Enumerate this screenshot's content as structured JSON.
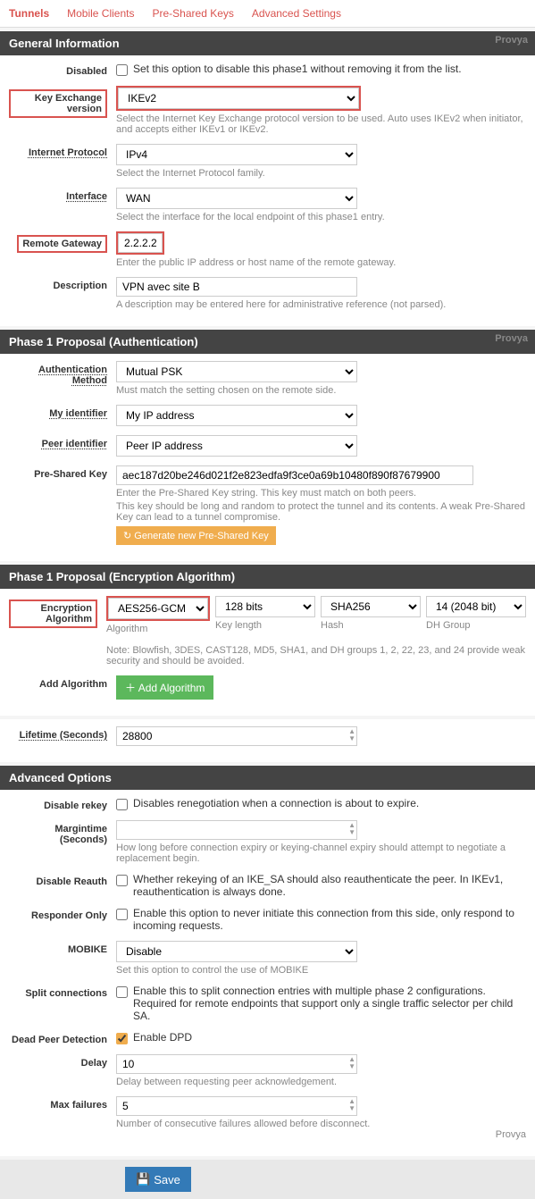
{
  "tabs": {
    "tunnels": "Tunnels",
    "mobile": "Mobile Clients",
    "psk": "Pre-Shared Keys",
    "adv": "Advanced Settings"
  },
  "watermark": "Provya",
  "general": {
    "title": "General Information",
    "disabled": {
      "label": "Disabled",
      "text": "Set this option to disable this phase1 without removing it from the list."
    },
    "kev": {
      "label": "Key Exchange version",
      "value": "IKEv2",
      "help": "Select the Internet Key Exchange protocol version to be used. Auto uses IKEv2 when initiator, and accepts either IKEv1 or IKEv2."
    },
    "ip": {
      "label": "Internet Protocol",
      "value": "IPv4",
      "help": "Select the Internet Protocol family."
    },
    "iface": {
      "label": "Interface",
      "value": "WAN",
      "help": "Select the interface for the local endpoint of this phase1 entry."
    },
    "rg": {
      "label": "Remote Gateway",
      "value": "2.2.2.2",
      "help": "Enter the public IP address or host name of the remote gateway."
    },
    "desc": {
      "label": "Description",
      "value": "VPN avec site B",
      "help": "A description may be entered here for administrative reference (not parsed)."
    }
  },
  "p1auth": {
    "title": "Phase 1 Proposal (Authentication)",
    "method": {
      "label": "Authentication Method",
      "value": "Mutual PSK",
      "help": "Must match the setting chosen on the remote side."
    },
    "myid": {
      "label": "My identifier",
      "value": "My IP address"
    },
    "peerid": {
      "label": "Peer identifier",
      "value": "Peer IP address"
    },
    "psk": {
      "label": "Pre-Shared Key",
      "value": "aec187d20be246d021f2e823edfa9f3ce0a69b10480f890f87679900",
      "help1": "Enter the Pre-Shared Key string. This key must match on both peers.",
      "help2": "This key should be long and random to protect the tunnel and its contents. A weak Pre-Shared Key can lead to a tunnel compromise.",
      "btn": "Generate new Pre-Shared Key"
    }
  },
  "p1enc": {
    "title": "Phase 1 Proposal (Encryption Algorithm)",
    "ealabel": "Encryption Algorithm",
    "alg": "AES256-GCM",
    "algsub": "Algorithm",
    "klen": "128 bits",
    "klensub": "Key length",
    "hash": "SHA256",
    "hashsub": "Hash",
    "dh": "14 (2048 bit)",
    "dhsub": "DH Group",
    "note": "Note: Blowfish, 3DES, CAST128, MD5, SHA1, and DH groups 1, 2, 22, 23, and 24 provide weak security and should be avoided.",
    "addlabel": "Add Algorithm",
    "addbtn": "Add Algorithm",
    "lifetime": {
      "label": "Lifetime (Seconds)",
      "value": "28800"
    }
  },
  "advopts": {
    "title": "Advanced Options",
    "rekey": {
      "label": "Disable rekey",
      "text": "Disables renegotiation when a connection is about to expire."
    },
    "margin": {
      "label": "Margintime (Seconds)",
      "value": "",
      "help": "How long before connection expiry or keying-channel expiry should attempt to negotiate a replacement begin."
    },
    "reauth": {
      "label": "Disable Reauth",
      "text": "Whether rekeying of an IKE_SA should also reauthenticate the peer. In IKEv1, reauthentication is always done."
    },
    "responder": {
      "label": "Responder Only",
      "text": "Enable this option to never initiate this connection from this side, only respond to incoming requests."
    },
    "mobike": {
      "label": "MOBIKE",
      "value": "Disable",
      "help": "Set this option to control the use of MOBIKE"
    },
    "split": {
      "label": "Split connections",
      "text": "Enable this to split connection entries with multiple phase 2 configurations. Required for remote endpoints that support only a single traffic selector per child SA."
    },
    "dpd": {
      "label": "Dead Peer Detection",
      "text": "Enable DPD"
    },
    "delay": {
      "label": "Delay",
      "value": "10",
      "help": "Delay between requesting peer acknowledgement."
    },
    "maxfail": {
      "label": "Max failures",
      "value": "5",
      "help": "Number of consecutive failures allowed before disconnect."
    }
  },
  "save": "Save"
}
